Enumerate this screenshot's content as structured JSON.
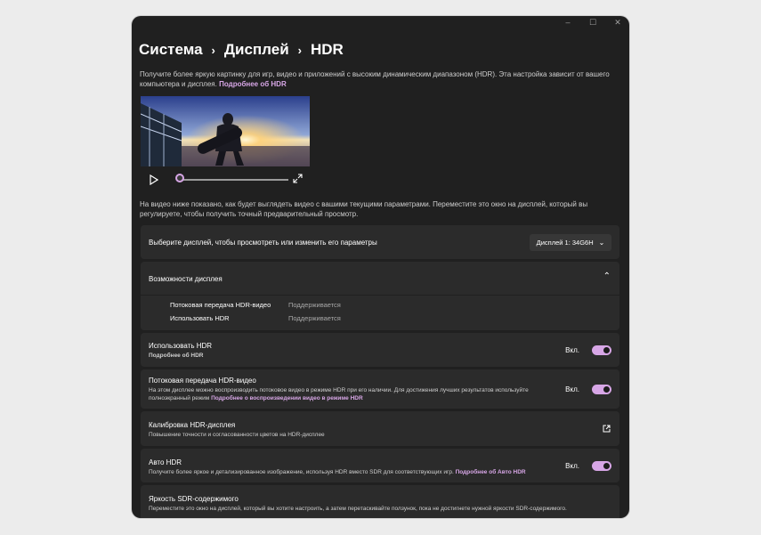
{
  "breadcrumb": {
    "item1": "Система",
    "item2": "Дисплей",
    "item3": "HDR"
  },
  "intro": {
    "text": "Получите более яркую картинку для игр, видео и приложений с высоким динамическим диапазоном (HDR). Эта настройка зависит от вашего компьютера и дисплея.",
    "link": "Подробнее об HDR"
  },
  "video_desc": "На видео ниже показано, как будет выглядеть видео с вашими текущими параметрами. Переместите это окно на дисплей, который вы регулируете, чтобы получить точный предварительный просмотр.",
  "display_select": {
    "label": "Выберите дисплей, чтобы просмотреть или изменить его параметры",
    "value": "Дисплей 1: 34G6H"
  },
  "capabilities": {
    "title": "Возможности дисплея",
    "rows": [
      {
        "name": "Потоковая передача HDR-видео",
        "value": "Поддерживается"
      },
      {
        "name": "Использовать HDR",
        "value": "Поддерживается"
      }
    ]
  },
  "use_hdr": {
    "title": "Использовать HDR",
    "link": "Подробнее об HDR",
    "state": "Вкл.",
    "on": true
  },
  "hdr_streaming": {
    "title": "Потоковая передача HDR-видео",
    "desc": "На этом дисплее можно воспроизводить потоковое видео в режиме HDR при его наличии. Для достижения лучших результатов используйте полноэкранный режим",
    "link": "Подробнее о воспроизведении видео в режиме HDR",
    "state": "Вкл.",
    "on": true
  },
  "calibration": {
    "title": "Калибровка HDR-дисплея",
    "desc": "Повышение точности и согласованности цветов на HDR-дисплее"
  },
  "auto_hdr": {
    "title": "Авто HDR",
    "desc": "Получите более яркое и детализированное изображение, используя HDR вместо SDR для соответствующих игр.",
    "link": "Подробнее об Авто HDR",
    "state": "Вкл.",
    "on": true
  },
  "sdr_brightness": {
    "title": "Яркость SDR-содержимого",
    "desc": "Переместите это окно на дисплей, который вы хотите настроить, а затем перетаскивайте ползунок, пока не достигнете нужной яркости SDR-содержимого."
  },
  "video_progress": 0,
  "colors": {
    "accent": "#d7a6e6",
    "background": "#202020",
    "card": "#2b2b2b"
  }
}
